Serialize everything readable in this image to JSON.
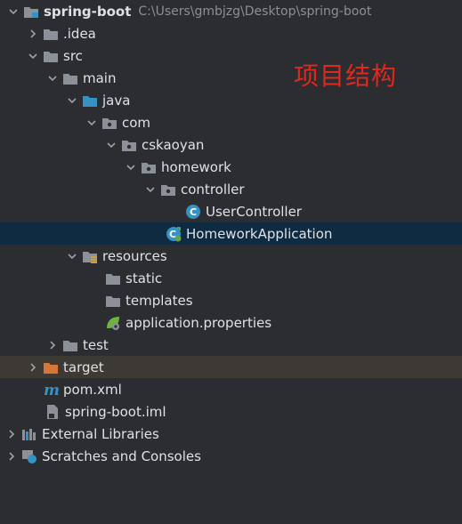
{
  "root": {
    "label": "spring-boot",
    "path": "C:\\Users\\gmbjzg\\Desktop\\spring-boot"
  },
  "annotation": "项目结构",
  "items": {
    "idea": ".idea",
    "src": "src",
    "main": "main",
    "java": "java",
    "com": "com",
    "cskaoyan": "cskaoyan",
    "homework": "homework",
    "controller": "controller",
    "user_controller": "UserController",
    "homework_application": "HomeworkApplication",
    "resources": "resources",
    "static": "static",
    "templates": "templates",
    "application_properties": "application.properties",
    "test": "test",
    "target": "target",
    "pom": "pom.xml",
    "iml": "spring-boot.iml",
    "external_libraries": "External Libraries",
    "scratches": "Scratches and Consoles"
  },
  "colors": {
    "folder": "#8c9199",
    "source_folder": "#3592c4",
    "resource_folder": "#c7a24e",
    "excluded_folder": "#d87637",
    "class": "#3592c4",
    "selection": "#0f2b41"
  }
}
